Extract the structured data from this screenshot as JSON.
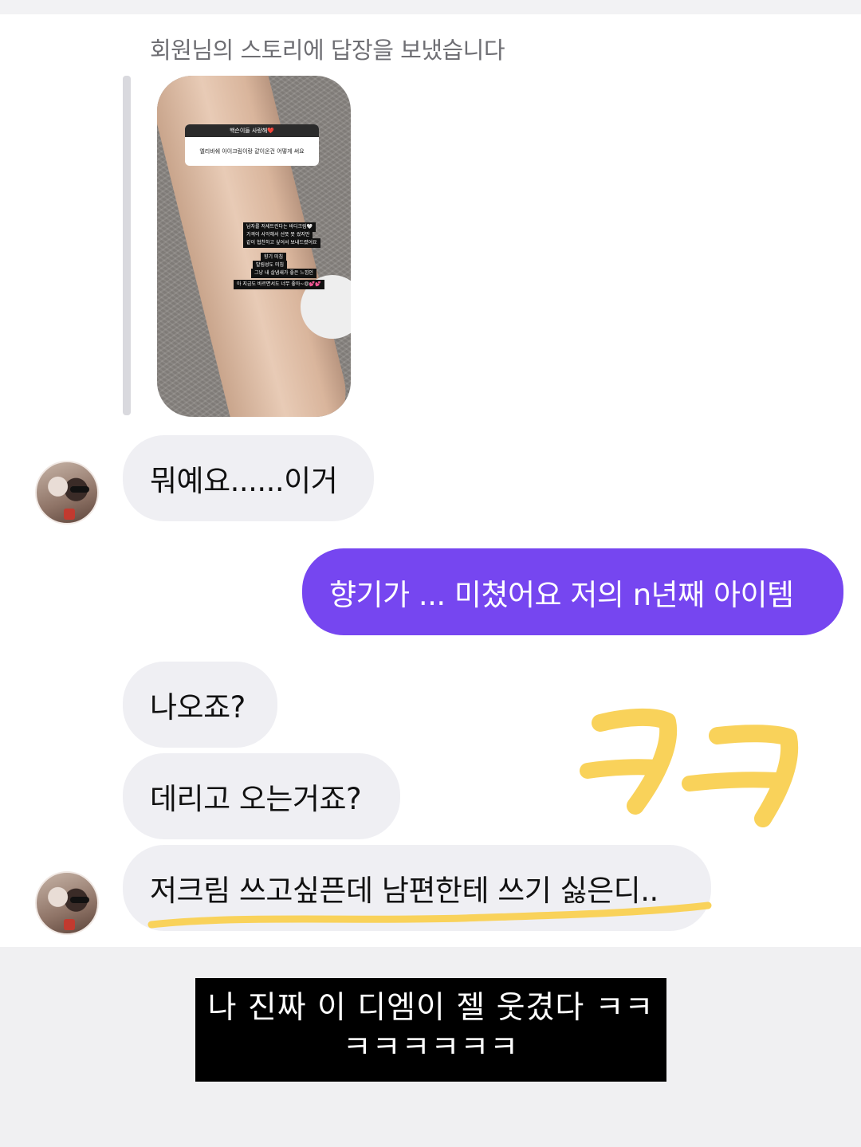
{
  "header": {
    "story_reply_caption": "회원님의 스토리에 답장을 보냈습니다"
  },
  "story": {
    "question_header": "핵슨이들 사랑해❤️",
    "question_text": "엘리바쉐 아이크림이랑 같이온건 어떻게 써요",
    "lines": [
      "남자를 저세트린다는 바디크림🤍",
      "가격이 사악해서 선뜻 못 썼지만",
      "같이 협찬하고 싶어서 보내드렸어요",
      "향기 미침",
      "발림성도 미침",
      "그냥 내 살냄새가 좋은 느낌인",
      "아 지금도 바르면서도 너무 좋아~😍💕💕"
    ]
  },
  "messages": [
    {
      "side": "in",
      "text": "뭐예요......이거"
    },
    {
      "side": "out",
      "text": "향기가 ... 미쳤어요 저의 n년째 아이템"
    },
    {
      "side": "in",
      "text": "나오죠?"
    },
    {
      "side": "in",
      "text": "데리고 오는거죠?"
    },
    {
      "side": "in",
      "text": "저크림 쓰고싶픈데 남편한테 쓰기 싫은디.."
    }
  ],
  "colors": {
    "outgoing_bubble": "#7646f0",
    "incoming_bubble": "#efeff3",
    "doodle_yellow": "#f9d25a"
  },
  "overlay_caption": {
    "line1": "나 진짜 이 디엠이 젤 웃겼다 ㅋㅋ",
    "line2": "ㅋㅋㅋㅋㅋㅋ"
  },
  "doodle_text": "ㅋㅋ"
}
